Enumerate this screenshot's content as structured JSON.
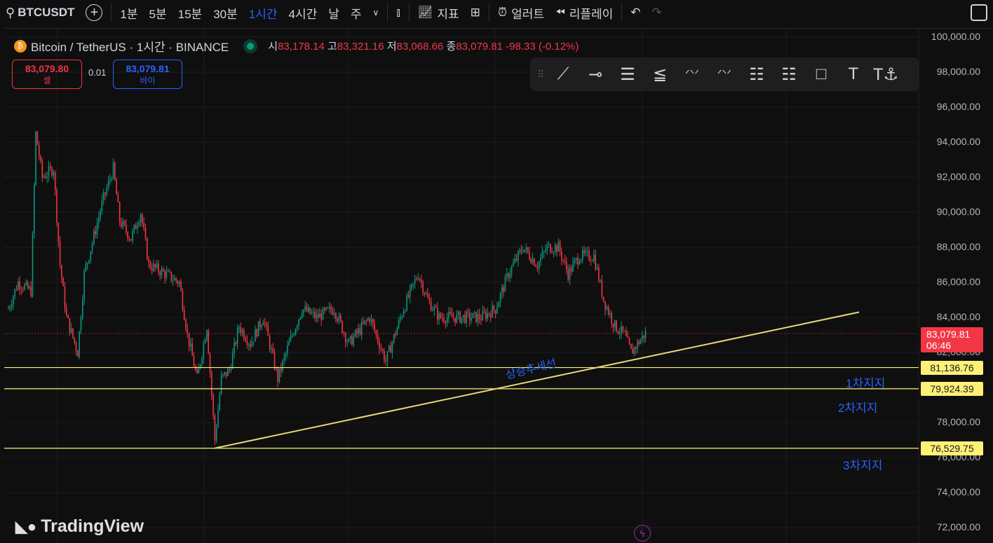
{
  "topbar": {
    "symbol": "BTCUSDT",
    "intervals": [
      "1분",
      "5분",
      "15분",
      "30분",
      "1시간",
      "4시간",
      "날",
      "주"
    ],
    "active_interval": "1시간",
    "indicators": "지표",
    "alert": "얼러트",
    "replay": "리플레이"
  },
  "legend": {
    "title": "Bitcoin / TetherUS · 1시간 · BINANCE",
    "o_label": "시",
    "o": "83,178.14",
    "h_label": "고",
    "h": "83,321.16",
    "l_label": "저",
    "l": "83,068.66",
    "c_label": "종",
    "c": "83,079.81",
    "change": "-98.33 (-0.12%)"
  },
  "trade": {
    "sell_price": "83,079.80",
    "sell_label": "셀",
    "spread": "0.01",
    "buy_price": "83,079.81",
    "buy_label": "바이"
  },
  "price_axis": {
    "labels": [
      "100,000.00",
      "98,000.00",
      "96,000.00",
      "94,000.00",
      "92,000.00",
      "90,000.00",
      "88,000.00",
      "86,000.00",
      "84,000.00",
      "82,000.00",
      "78,000.00",
      "76,000.00",
      "74,000.00",
      "72,000.00"
    ],
    "current_price": "83,079.81",
    "countdown": "06:46"
  },
  "levels": [
    {
      "price": "81,136.76",
      "value": 81136.76,
      "label": "1차지지"
    },
    {
      "price": "79,924.39",
      "value": 79924.39,
      "label": "2차지지"
    },
    {
      "price": "76,529.75",
      "value": 76529.75,
      "label": "3차지지"
    }
  ],
  "trendline": {
    "label": "상승추세선",
    "start": 76529.75,
    "end": 84300
  },
  "branding": "TradingView",
  "colors": {
    "up": "#089981",
    "down": "#f23645",
    "level": "#fff176",
    "annot": "#2962ff"
  },
  "chart_data": {
    "type": "candlestick",
    "ylim": [
      72000,
      100000
    ],
    "price_path": [
      [
        0,
        84500
      ],
      [
        6,
        86000
      ],
      [
        14,
        85500
      ],
      [
        17,
        94500
      ],
      [
        21,
        92000
      ],
      [
        28,
        92500
      ],
      [
        32,
        87000
      ],
      [
        36,
        84000
      ],
      [
        43,
        82000
      ],
      [
        47,
        86500
      ],
      [
        54,
        89000
      ],
      [
        58,
        90500
      ],
      [
        65,
        92500
      ],
      [
        69,
        89500
      ],
      [
        76,
        88500
      ],
      [
        82,
        90000
      ],
      [
        87,
        87000
      ],
      [
        97,
        86500
      ],
      [
        106,
        86000
      ],
      [
        111,
        83000
      ],
      [
        117,
        80500
      ],
      [
        123,
        83500
      ],
      [
        128,
        77000
      ],
      [
        132,
        80500
      ],
      [
        137,
        81000
      ],
      [
        143,
        83500
      ],
      [
        150,
        82500
      ],
      [
        158,
        84000
      ],
      [
        167,
        80500
      ],
      [
        174,
        82500
      ],
      [
        182,
        84500
      ],
      [
        191,
        84000
      ],
      [
        202,
        84500
      ],
      [
        211,
        82500
      ],
      [
        224,
        84000
      ],
      [
        234,
        81500
      ],
      [
        245,
        84500
      ],
      [
        254,
        86500
      ],
      [
        260,
        85000
      ],
      [
        267,
        84000
      ],
      [
        276,
        84000
      ],
      [
        293,
        84000
      ],
      [
        302,
        84500
      ],
      [
        310,
        86500
      ],
      [
        319,
        88000
      ],
      [
        328,
        87000
      ],
      [
        334,
        88000
      ],
      [
        341,
        88000
      ],
      [
        347,
        86500
      ],
      [
        354,
        87500
      ],
      [
        363,
        87500
      ],
      [
        369,
        85000
      ],
      [
        376,
        83500
      ],
      [
        382,
        83000
      ],
      [
        386,
        82000
      ],
      [
        395,
        83100
      ]
    ]
  }
}
